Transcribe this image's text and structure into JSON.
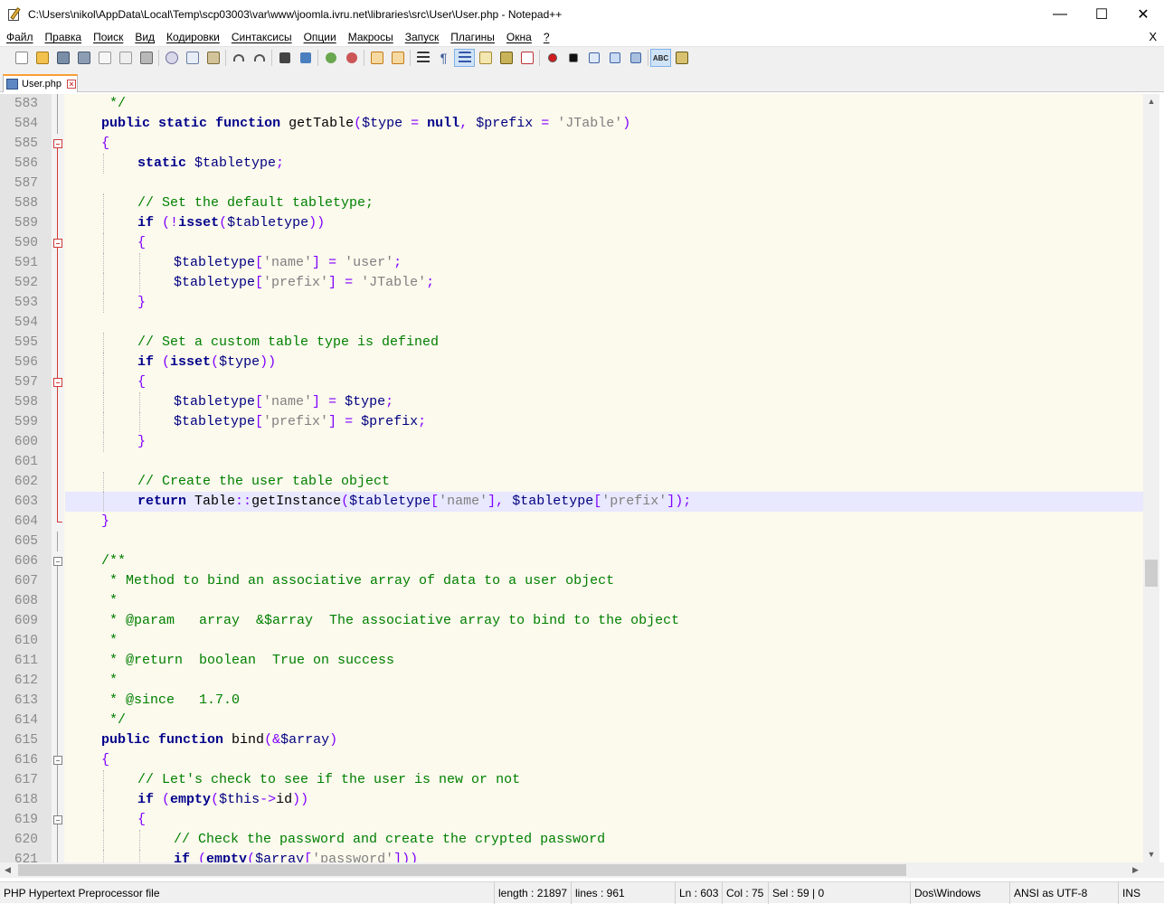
{
  "window": {
    "title": "C:\\Users\\nikol\\AppData\\Local\\Temp\\scp03003\\var\\www\\joomla.ivru.net\\libraries\\src\\User\\User.php - Notepad++",
    "minimize": "—",
    "maximize": "☐",
    "close": "✕"
  },
  "menu": {
    "items": [
      "Файл",
      "Правка",
      "Поиск",
      "Вид",
      "Кодировки",
      "Синтаксисы",
      "Опции",
      "Макросы",
      "Запуск",
      "Плагины",
      "Окна",
      "?"
    ],
    "close_doc": "X"
  },
  "toolbar": {
    "icons": [
      "new-file-icon",
      "open-file-icon",
      "save-icon",
      "save-all-icon",
      "close-icon",
      "close-all-icon",
      "print-icon",
      "cut-icon",
      "copy-icon",
      "paste-icon",
      "undo-icon",
      "redo-icon",
      "find-icon",
      "replace-icon",
      "zoom-in-icon",
      "zoom-out-icon",
      "sync-vertical-icon",
      "sync-horizontal-icon",
      "word-wrap-icon",
      "show-all-chars-icon",
      "indent-guide-icon",
      "doc-map-icon",
      "function-list-icon",
      "folder-workspace-icon",
      "record-macro-icon",
      "stop-macro-icon",
      "play-macro-icon",
      "run-macro-multiple-icon",
      "save-macro-icon",
      "spell-check-icon",
      "spell-settings-icon"
    ]
  },
  "tab": {
    "label": "User.php",
    "close": "✕"
  },
  "editor": {
    "lines": [
      {
        "n": "583",
        "text": "\t */"
      },
      {
        "n": "584",
        "text": "\tpublic static function getTable($type = null, $prefix = 'JTable')"
      },
      {
        "n": "585",
        "text": "\t{"
      },
      {
        "n": "586",
        "text": "\t\tstatic $tabletype;"
      },
      {
        "n": "587",
        "text": ""
      },
      {
        "n": "588",
        "text": "\t\t// Set the default tabletype;"
      },
      {
        "n": "589",
        "text": "\t\tif (!isset($tabletype))"
      },
      {
        "n": "590",
        "text": "\t\t{"
      },
      {
        "n": "591",
        "text": "\t\t\t$tabletype['name'] = 'user';"
      },
      {
        "n": "592",
        "text": "\t\t\t$tabletype['prefix'] = 'JTable';"
      },
      {
        "n": "593",
        "text": "\t\t}"
      },
      {
        "n": "594",
        "text": ""
      },
      {
        "n": "595",
        "text": "\t\t// Set a custom table type is defined"
      },
      {
        "n": "596",
        "text": "\t\tif (isset($type))"
      },
      {
        "n": "597",
        "text": "\t\t{"
      },
      {
        "n": "598",
        "text": "\t\t\t$tabletype['name'] = $type;"
      },
      {
        "n": "599",
        "text": "\t\t\t$tabletype['prefix'] = $prefix;"
      },
      {
        "n": "600",
        "text": "\t\t}"
      },
      {
        "n": "601",
        "text": ""
      },
      {
        "n": "602",
        "text": "\t\t// Create the user table object"
      },
      {
        "n": "603",
        "text": "\t\treturn Table::getInstance($tabletype['name'], $tabletype['prefix']);"
      },
      {
        "n": "604",
        "text": "\t}"
      },
      {
        "n": "605",
        "text": ""
      },
      {
        "n": "606",
        "text": "\t/**"
      },
      {
        "n": "607",
        "text": "\t * Method to bind an associative array of data to a user object"
      },
      {
        "n": "608",
        "text": "\t *"
      },
      {
        "n": "609",
        "text": "\t * @param   array  &$array  The associative array to bind to the object"
      },
      {
        "n": "610",
        "text": "\t *"
      },
      {
        "n": "611",
        "text": "\t * @return  boolean  True on success"
      },
      {
        "n": "612",
        "text": "\t *"
      },
      {
        "n": "613",
        "text": "\t * @since   1.7.0"
      },
      {
        "n": "614",
        "text": "\t */"
      },
      {
        "n": "615",
        "text": "\tpublic function bind(&$array)"
      },
      {
        "n": "616",
        "text": "\t{"
      },
      {
        "n": "617",
        "text": "\t\t// Let's check to see if the user is new or not"
      },
      {
        "n": "618",
        "text": "\t\tif (empty($this->id))"
      },
      {
        "n": "619",
        "text": "\t\t{"
      },
      {
        "n": "620",
        "text": "\t\t\t// Check the password and create the crypted password"
      },
      {
        "n": "621",
        "text": "\t\t\tif (empty($array['password']))"
      }
    ],
    "current_line": "603",
    "colors": {
      "keyword": "#00008b",
      "comment": "#008000",
      "string": "#808080",
      "variable": "#000080",
      "operator": "#8000ff",
      "background": "#fcf9ed",
      "current_line_bg": "#e8e8ff"
    }
  },
  "status": {
    "file_type": "PHP Hypertext Preprocessor file",
    "length": "length : 21897",
    "lines": "lines : 961",
    "ln": "Ln : 603",
    "col": "Col : 75",
    "sel": "Sel : 59 | 0",
    "eol": "Dos\\Windows",
    "encoding": "ANSI as UTF-8",
    "mode": "INS"
  }
}
